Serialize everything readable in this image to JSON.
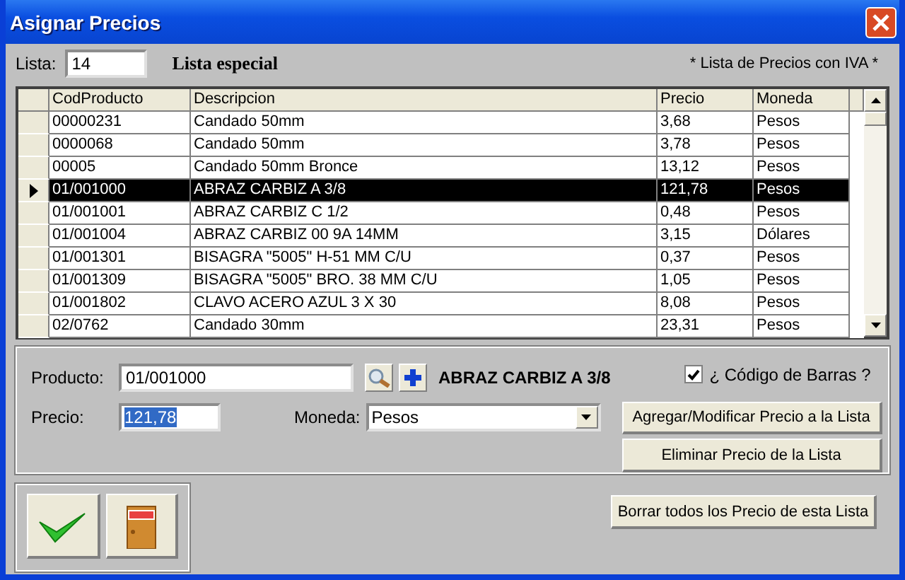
{
  "window": {
    "title": "Asignar Precios"
  },
  "lista": {
    "label": "Lista:",
    "value": "14",
    "name": "Lista especial",
    "note": "* Lista de Precios con IVA *"
  },
  "table": {
    "columns": [
      "CodProducto",
      "Descripcion",
      "Precio",
      "Moneda"
    ],
    "rows": [
      {
        "cells": [
          "00000231",
          "Candado 50mm",
          "3,68",
          "Pesos"
        ],
        "selected": false
      },
      {
        "cells": [
          "0000068",
          "Candado 50mm",
          "3,78",
          "Pesos"
        ],
        "selected": false
      },
      {
        "cells": [
          "00005",
          "Candado 50mm Bronce",
          "13,12",
          "Pesos"
        ],
        "selected": false
      },
      {
        "cells": [
          "01/001000",
          "ABRAZ CARBIZ A 3/8",
          "121,78",
          "Pesos"
        ],
        "selected": true
      },
      {
        "cells": [
          "01/001001",
          "ABRAZ CARBIZ C 1/2",
          "0,48",
          "Pesos"
        ],
        "selected": false
      },
      {
        "cells": [
          "01/001004",
          "ABRAZ CARBIZ 00 9A 14MM",
          "3,15",
          "Dólares"
        ],
        "selected": false
      },
      {
        "cells": [
          "01/001301",
          "BISAGRA \"5005\" H-51 MM C/U",
          "0,37",
          "Pesos"
        ],
        "selected": false
      },
      {
        "cells": [
          "01/001309",
          "BISAGRA \"5005\" BRO. 38 MM C/U",
          "1,05",
          "Pesos"
        ],
        "selected": false
      },
      {
        "cells": [
          "01/001802",
          "CLAVO ACERO AZUL 3 X 30",
          "8,08",
          "Pesos"
        ],
        "selected": false
      },
      {
        "cells": [
          "02/0762",
          "Candado 30mm",
          "23,31",
          "Pesos"
        ],
        "selected": false
      }
    ]
  },
  "form": {
    "producto_label": "Producto:",
    "producto": "01/001000",
    "producto_name": "ABRAZ CARBIZ A 3/8",
    "precio_label": "Precio:",
    "precio": "121,78",
    "precio_selected": true,
    "moneda_label": "Moneda:",
    "moneda": "Pesos",
    "barcode": {
      "label": "¿ Código de Barras ?",
      "checked": true
    },
    "buttons": [
      "Agregar/Modificar Precio a la Lista",
      "Eliminar Precio de la Lista"
    ]
  },
  "clear_button": "Borrar todos los Precio de esta Lista"
}
